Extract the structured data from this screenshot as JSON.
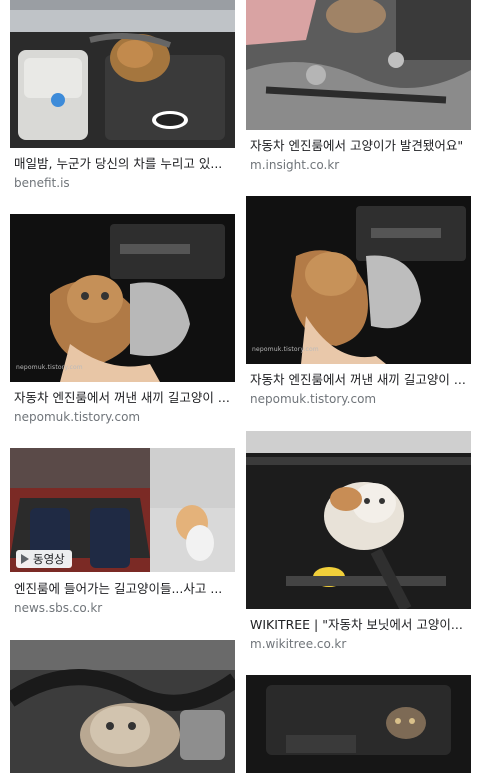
{
  "results": {
    "left": [
      {
        "title": "매일밤, 누군가 당신의 차를 누리고 있...",
        "source": "benefit.is"
      },
      {
        "title": "자동차 엔진룸에서 꺼낸 새끼 길고양이 ...",
        "source": "nepomuk.tistory.com",
        "watermark": "nepomuk.tistory.com"
      },
      {
        "title": "엔진룸에 들어가는 길고양이들...사고 ...",
        "source": "news.sbs.co.kr",
        "badge": "동영상",
        "badge_icon": "play-icon"
      },
      {
        "title": "",
        "source": ""
      }
    ],
    "right": [
      {
        "title": "자동차 엔진룸에서 고양이가 발견됐어요\"",
        "source": "m.insight.co.kr"
      },
      {
        "title": "자동차 엔진룸에서 꺼낸 새끼 길고양이 ...",
        "source": "nepomuk.tistory.com",
        "watermark": "nepomuk.tistory.com"
      },
      {
        "title": "WIKITREE | \"자동차 보닛에서 고양이...",
        "source": "m.wikitree.co.kr"
      },
      {
        "title": "",
        "source": ""
      }
    ]
  },
  "colors": {
    "title": "#202124",
    "source": "#70757a",
    "background": "#ffffff"
  }
}
